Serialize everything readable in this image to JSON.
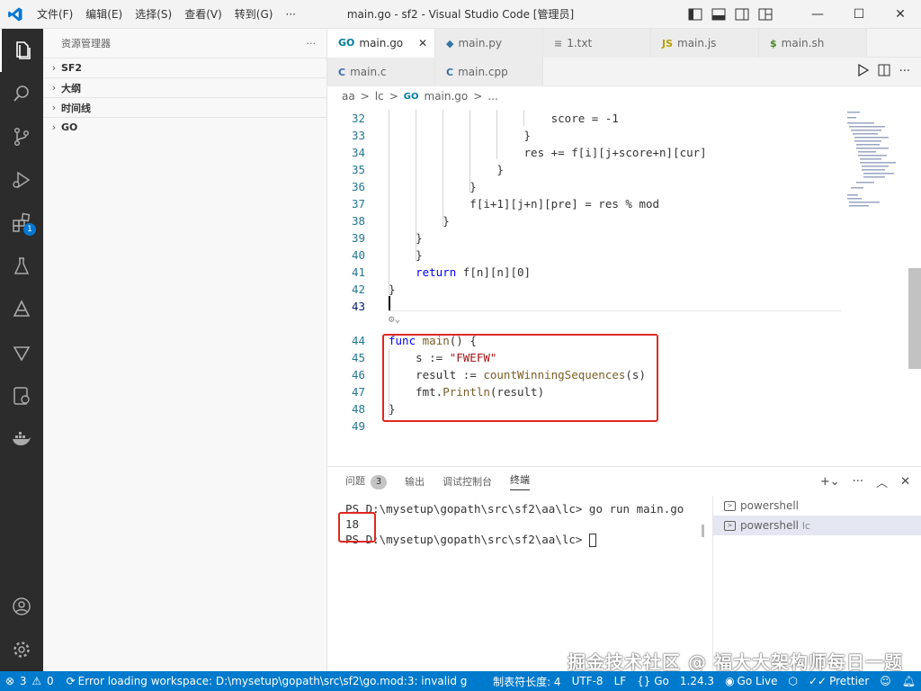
{
  "window": {
    "title": "main.go - sf2 - Visual Studio Code [管理员]",
    "menu": [
      "文件(F)",
      "编辑(E)",
      "选择(S)",
      "查看(V)",
      "转到(G)",
      "···"
    ]
  },
  "activitybar": {
    "extensions_badge": "1"
  },
  "sidebar": {
    "title": "资源管理器",
    "more": "···",
    "sections": [
      "SF2",
      "大纲",
      "时间线",
      "GO"
    ]
  },
  "tabs": {
    "row1": [
      {
        "icon": "GO",
        "label": "main.go",
        "close": "✕"
      },
      {
        "icon": "◆",
        "label": "main.py"
      },
      {
        "icon": "≡",
        "label": "1.txt"
      },
      {
        "icon": "JS",
        "label": "main.js"
      },
      {
        "icon": "$",
        "label": "main.sh"
      }
    ],
    "row2": [
      {
        "icon": "C",
        "label": "main.c"
      },
      {
        "icon": "C",
        "label": "main.cpp"
      }
    ]
  },
  "breadcrumb": {
    "parts": [
      "aa",
      ">",
      "lc",
      ">",
      "GO",
      "main.go",
      ">",
      "..."
    ]
  },
  "code": {
    "lines": [
      {
        "n": "32",
        "segs": [
          [
            "",
            "                        score = -1"
          ]
        ]
      },
      {
        "n": "33",
        "segs": [
          [
            "",
            "                    }"
          ]
        ]
      },
      {
        "n": "34",
        "segs": [
          [
            "",
            "                    res += f[i][j+score+n][cur]"
          ]
        ]
      },
      {
        "n": "35",
        "segs": [
          [
            "",
            "                }"
          ]
        ]
      },
      {
        "n": "36",
        "segs": [
          [
            "",
            "            }"
          ]
        ]
      },
      {
        "n": "37",
        "segs": [
          [
            "",
            "            f[i+1][j+n][pre] = res % mod"
          ]
        ]
      },
      {
        "n": "38",
        "segs": [
          [
            "",
            "        }"
          ]
        ]
      },
      {
        "n": "39",
        "segs": [
          [
            "",
            "    }"
          ]
        ]
      },
      {
        "n": "40",
        "segs": [
          [
            "",
            "    }"
          ]
        ]
      },
      {
        "n": "41",
        "segs": [
          [
            "",
            "    "
          ],
          [
            "kw",
            "return"
          ],
          [
            "",
            " f[n][n][0]"
          ]
        ]
      },
      {
        "n": "42",
        "segs": [
          [
            "",
            "}"
          ]
        ]
      },
      {
        "n": "43",
        "segs": [
          [
            "",
            ""
          ]
        ]
      },
      {
        "n": "44",
        "segs": [
          [
            "kw",
            "func"
          ],
          [
            "",
            " "
          ],
          [
            "fn",
            "main"
          ],
          [
            "",
            "() {"
          ]
        ]
      },
      {
        "n": "45",
        "segs": [
          [
            "",
            "    s := "
          ],
          [
            "str",
            "\"FWEFW\""
          ]
        ]
      },
      {
        "n": "46",
        "segs": [
          [
            "",
            "    result := "
          ],
          [
            "fn",
            "countWinningSequences"
          ],
          [
            "",
            "(s)"
          ]
        ]
      },
      {
        "n": "47",
        "segs": [
          [
            "",
            "    fmt."
          ],
          [
            "fn",
            "Println"
          ],
          [
            "",
            "(result)"
          ]
        ]
      },
      {
        "n": "48",
        "segs": [
          [
            "",
            "}"
          ]
        ]
      },
      {
        "n": "49",
        "segs": [
          [
            "",
            ""
          ]
        ]
      }
    ]
  },
  "panel": {
    "tabs": [
      {
        "label": "问题",
        "badge": "3"
      },
      {
        "label": "输出"
      },
      {
        "label": "调试控制台"
      },
      {
        "label": "终端"
      }
    ],
    "terminal_lines": [
      "PS D:\\mysetup\\gopath\\src\\sf2\\aa\\lc> go run main.go",
      "18",
      "PS D:\\mysetup\\gopath\\src\\sf2\\aa\\lc> "
    ],
    "terminals": [
      {
        "label": "powershell",
        "suffix": ""
      },
      {
        "label": "powershell",
        "suffix": "lc"
      }
    ]
  },
  "statusbar": {
    "errors": "3",
    "warnings": "0",
    "message": "Error loading workspace: D:\\mysetup\\gopath\\src\\sf2\\go.mod:3: invalid g",
    "indent": "制表符长度: 4",
    "encoding": "UTF-8",
    "eol": "LF",
    "language": "{} Go",
    "go_version": "1.24.3",
    "live": "Go Live",
    "prettier": "Prettier"
  },
  "watermark": "掘金技术社区 @ 福大大架构师每日一题",
  "colors": {
    "accent": "#007acc",
    "activitybar": "#2c2c2c",
    "highlight": "#e0281e"
  }
}
